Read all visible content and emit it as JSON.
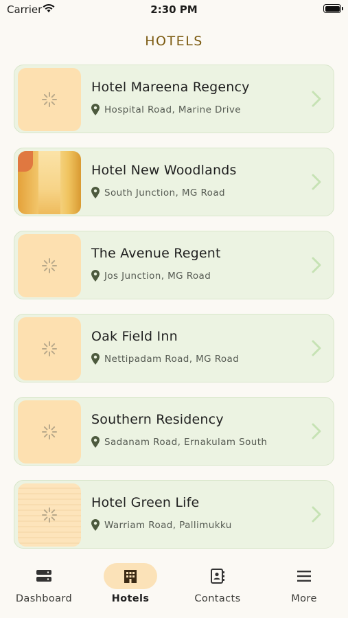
{
  "status": {
    "carrier": "Carrier",
    "time": "2:30 PM"
  },
  "header": {
    "title": "HOTELS"
  },
  "hotels": [
    {
      "name": "Hotel Mareena Regency",
      "address": "Hospital Road, Marine Drive",
      "image": "loading"
    },
    {
      "name": "Hotel New Woodlands",
      "address": "South Junction, MG Road",
      "image": "photo"
    },
    {
      "name": "The Avenue Regent",
      "address": "Jos Junction, MG Road",
      "image": "loading"
    },
    {
      "name": "Oak Field Inn",
      "address": "Nettipadam Road, MG Road",
      "image": "loading"
    },
    {
      "name": "Southern Residency",
      "address": "Sadanam Road, Ernakulam South",
      "image": "loading"
    },
    {
      "name": "Hotel Green Life",
      "address": "Warriam Road, Pallimukku",
      "image": "loading-faded"
    }
  ],
  "tabs": [
    {
      "label": "Dashboard",
      "icon": "dashboard-icon",
      "active": false
    },
    {
      "label": "Hotels",
      "icon": "building-icon",
      "active": true
    },
    {
      "label": "Contacts",
      "icon": "contacts-icon",
      "active": false
    },
    {
      "label": "More",
      "icon": "menu-icon",
      "active": false
    }
  ],
  "colors": {
    "accent": "#7b5a10",
    "card": "#ecf3e2",
    "thumb": "#fde0b0",
    "active_pill": "#fbe2b8",
    "pin": "#4d5a3e",
    "chevron": "#c6e2b4"
  }
}
